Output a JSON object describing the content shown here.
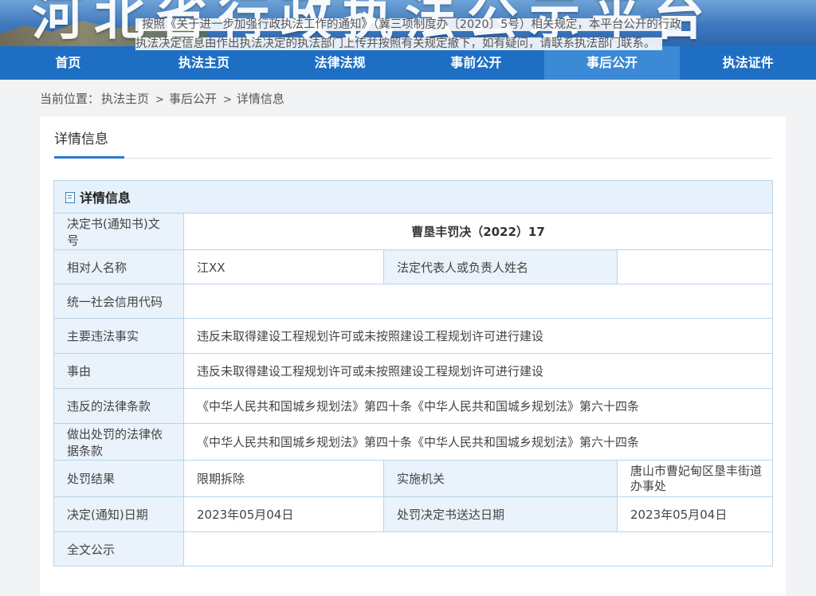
{
  "banner": {
    "title": "河北省行政执法公示平台",
    "notice": "按照《关于进一步加强行政执法工作的通知》（冀三项制度办〔2020〕5号）相关规定，本平台公开的行政执法决定信息由作出执法决定的执法部门上传并按照有关规定撤下，如有疑问，请联系执法部门联系。"
  },
  "nav": [
    {
      "label": "首页",
      "active": false
    },
    {
      "label": "执法主页",
      "active": false
    },
    {
      "label": "法律法规",
      "active": false
    },
    {
      "label": "事前公开",
      "active": false
    },
    {
      "label": "事后公开",
      "active": true
    },
    {
      "label": "执法证件",
      "active": false
    }
  ],
  "breadcrumb": {
    "prefix": "当前位置：",
    "items": [
      "执法主页",
      "事后公开",
      "详情信息"
    ],
    "separator": ">"
  },
  "tab": {
    "label": "详情信息"
  },
  "detail": {
    "header": "详情信息",
    "doc_no_label": "决定书(通知书)文号",
    "doc_no": "曹垦丰罚决（2022）17",
    "party_label": "相对人名称",
    "party": "江XX",
    "legal_rep_label": "法定代表人或负责人姓名",
    "legal_rep": "",
    "credit_code_label": "统一社会信用代码",
    "credit_code": "",
    "facts_label": "主要违法事实",
    "facts": "违反未取得建设工程规划许可或未按照建设工程规划许可进行建设",
    "reason_label": "事由",
    "reason": "违反未取得建设工程规划许可或未按照建设工程规划许可进行建设",
    "violated_label": "违反的法律条款",
    "violated": "《中华人民共和国城乡规划法》第四十条《中华人民共和国城乡规划法》第六十四条",
    "basis_label": "做出处罚的法律依据条款",
    "basis": "《中华人民共和国城乡规划法》第四十条《中华人民共和国城乡规划法》第六十四条",
    "result_label": "处罚结果",
    "result": "限期拆除",
    "agency_label": "实施机关",
    "agency": "唐山市曹妃甸区垦丰街道办事处",
    "date_label": "决定(通知)日期",
    "date": "2023年05月04日",
    "delivery_label": "处罚决定书送达日期",
    "delivery": "2023年05月04日",
    "fulltext_label": "全文公示",
    "fulltext": ""
  }
}
